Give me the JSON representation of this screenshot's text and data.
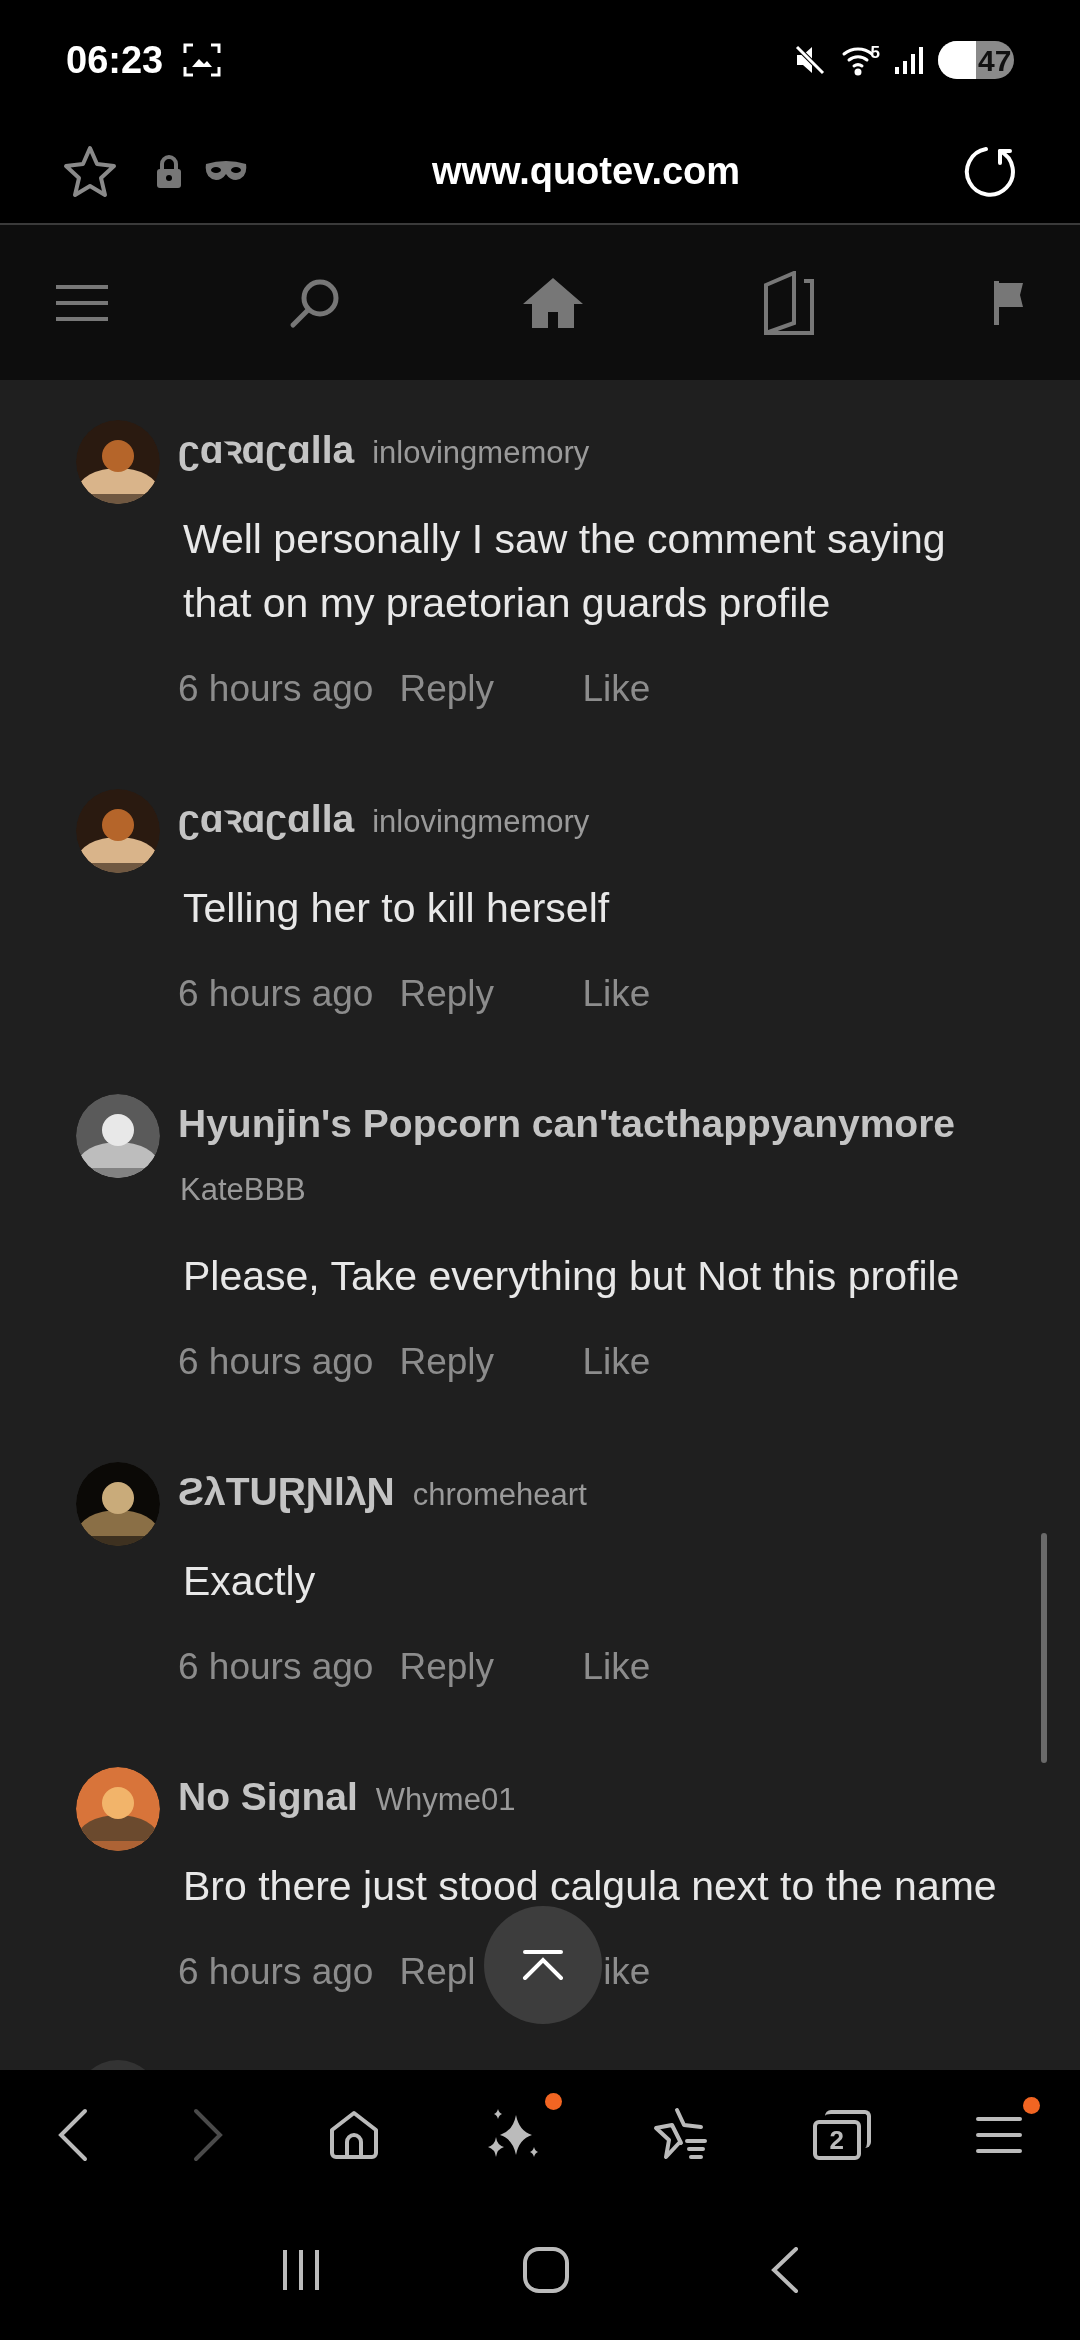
{
  "status_bar": {
    "time": "06:23",
    "wifi_label": "5",
    "battery": "47"
  },
  "address_bar": {
    "url": "www.quotev.com"
  },
  "comments": [
    {
      "display_name": "ʗɑꝛɑʗɑlla",
      "username": "inlovingmemory",
      "text": "Well personally I saw the comment saying that on my praetorian guards profile",
      "time": "6 hours ago",
      "reply": "Reply",
      "like": "Like"
    },
    {
      "display_name": "ʗɑꝛɑʗɑlla",
      "username": "inlovingmemory",
      "text": "Telling her to kill herself",
      "time": "6 hours ago",
      "reply": "Reply",
      "like": "Like"
    },
    {
      "display_name": "Hyunjin's Popcorn can'tacthappyanymore",
      "username": "KateBBB",
      "text": "Please, Take everything but Not this profile",
      "time": "6 hours ago",
      "reply": "Reply",
      "like": "Like"
    },
    {
      "display_name": "ƧλTUⱤƝlλƝ",
      "username": "chromeheart",
      "text": "Exactly",
      "time": "6 hours ago",
      "reply": "Reply",
      "like": "Like"
    },
    {
      "display_name": "No Signal",
      "username": "Whyme01",
      "text": "Bro there just stood calgula next to the name",
      "time": "6 hours ago",
      "reply": "Repl",
      "like": "ike"
    }
  ],
  "browser_toolbar": {
    "forward_disabled": true,
    "assistant_badge": true,
    "tab_count": "2",
    "menu_badge": true
  }
}
